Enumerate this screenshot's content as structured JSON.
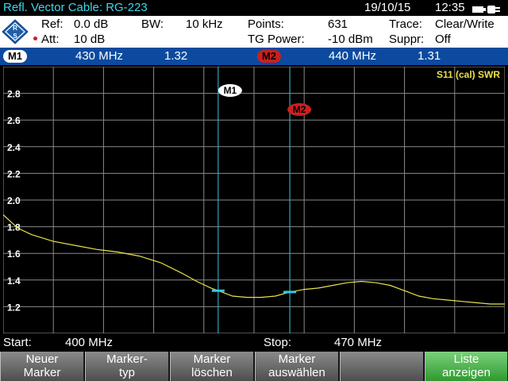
{
  "title": "Refl. Vector  Cable: RG-223",
  "date": "19/10/15",
  "time": "12:35",
  "info": {
    "ref_label": "Ref:",
    "ref_value": "0.0 dB",
    "att_label": "Att:",
    "att_value": "10 dB",
    "bw_label": "BW:",
    "bw_value": "10 kHz",
    "points_label": "Points:",
    "points_value": "631",
    "tg_label": "TG Power:",
    "tg_value": "-10 dBm",
    "trace_label": "Trace:",
    "trace_value": "Clear/Write",
    "suppr_label": "Suppr:",
    "suppr_value": "Off"
  },
  "markers_bar": {
    "m1_label": "M1",
    "m1_freq": "430  MHz",
    "m1_value": "1.32",
    "m2_label": "M2",
    "m2_freq": "440  MHz",
    "m2_value": "1.31"
  },
  "trace_label": "S11 (cal) SWR",
  "chart_data": {
    "type": "line",
    "x_unit": "MHz",
    "xlim": [
      400,
      470
    ],
    "ylim": [
      1.0,
      3.0
    ],
    "y_ticks": [
      1.2,
      1.4,
      1.6,
      1.8,
      2.0,
      2.2,
      2.4,
      2.6,
      2.8
    ],
    "x": [
      400,
      402,
      404,
      407,
      410,
      413,
      416,
      419,
      422,
      425,
      427,
      429,
      430,
      432,
      434,
      436,
      438,
      440,
      442,
      444,
      446,
      448,
      450,
      452,
      454,
      456,
      458,
      460,
      462,
      464,
      466,
      468,
      470
    ],
    "y": [
      1.89,
      1.79,
      1.74,
      1.69,
      1.66,
      1.63,
      1.61,
      1.58,
      1.53,
      1.45,
      1.39,
      1.34,
      1.32,
      1.28,
      1.27,
      1.27,
      1.28,
      1.31,
      1.33,
      1.34,
      1.36,
      1.38,
      1.39,
      1.38,
      1.36,
      1.32,
      1.28,
      1.26,
      1.25,
      1.24,
      1.23,
      1.22,
      1.22
    ],
    "markers": [
      {
        "name": "M1",
        "x": 430,
        "y": 1.32
      },
      {
        "name": "M2",
        "x": 440,
        "y": 1.31
      }
    ]
  },
  "start_label": "Start:",
  "start_value": "400 MHz",
  "stop_label": "Stop:",
  "stop_value": "470 MHz",
  "softkeys": [
    {
      "line1": "Neuer",
      "line2": "Marker"
    },
    {
      "line1": "Marker-",
      "line2": "typ"
    },
    {
      "line1": "Marker",
      "line2": "löschen"
    },
    {
      "line1": "Marker",
      "line2": "auswählen"
    },
    {
      "line1": "",
      "line2": ""
    },
    {
      "line1": "Liste",
      "line2": "anzeigen"
    }
  ],
  "colors": {
    "trace": "#e8e24a",
    "marker_line": "#39c6e0",
    "marker_bar": "#0b4a9e",
    "m2_badge": "#cc1f1f",
    "title_text": "#3fd6ea",
    "active_softkey": "#4cb84c"
  }
}
